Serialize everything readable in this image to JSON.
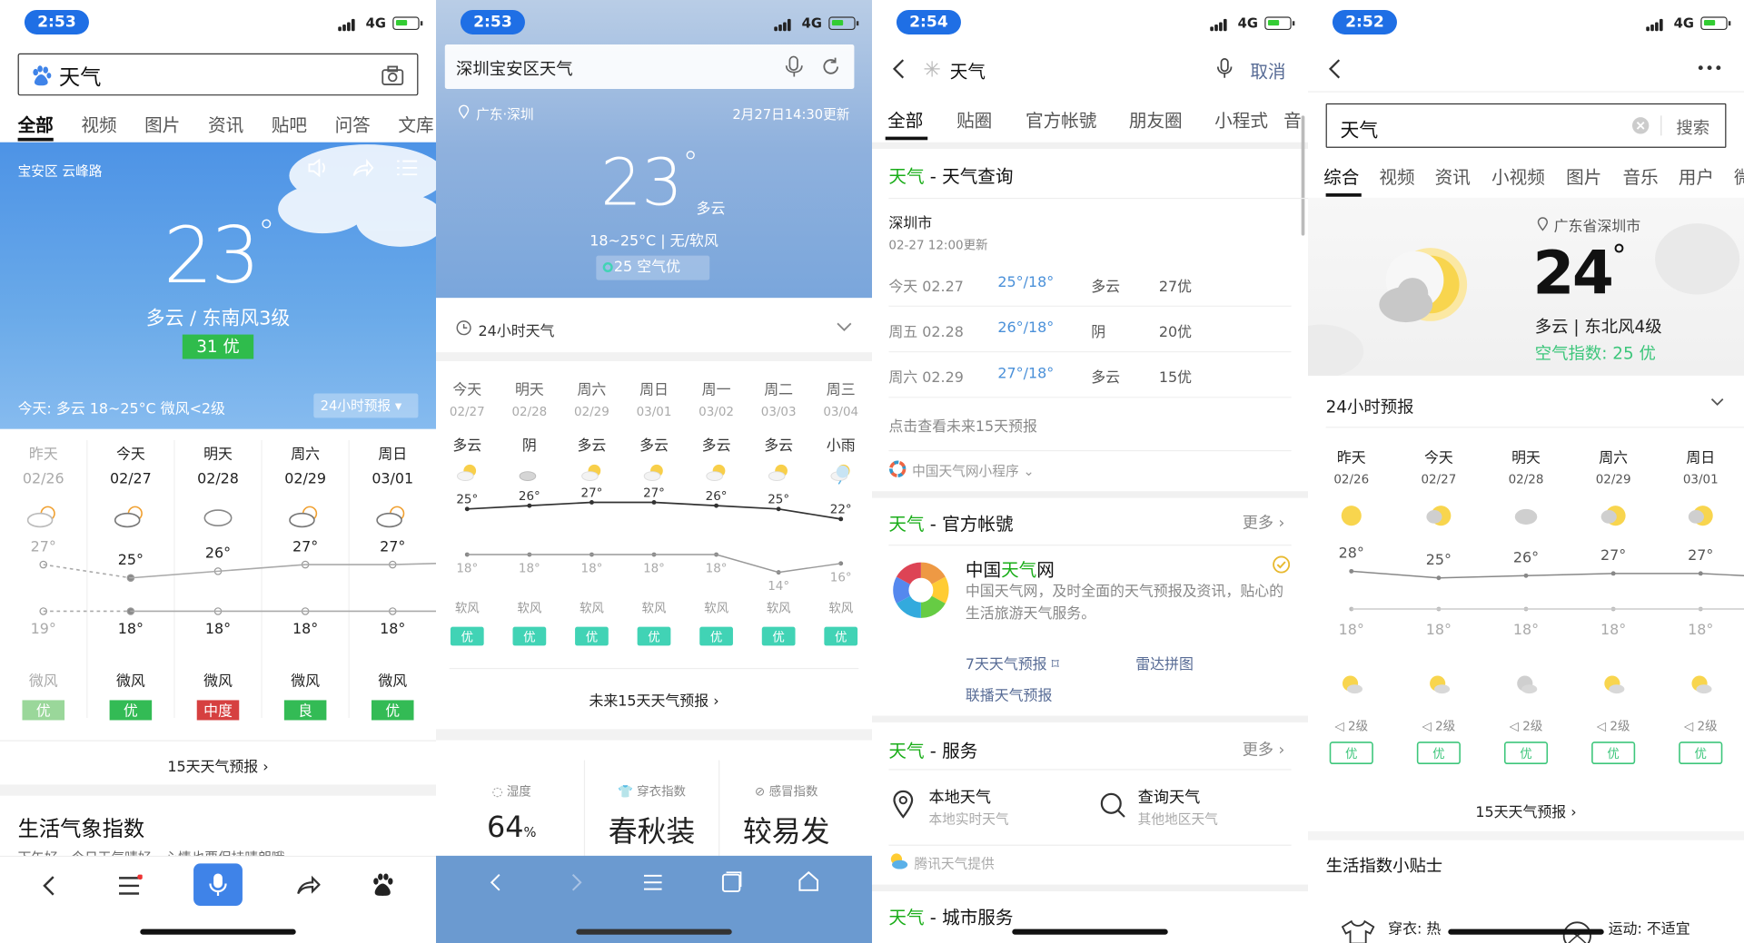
{
  "colors": {
    "baidu_blue": "#3f83e8",
    "green": "#33bb55",
    "orange": "#f0a030",
    "red": "#d64040",
    "teal": "#41d3b5"
  },
  "p1": {
    "time": "2:53",
    "net": "4G",
    "search_value": "天气",
    "tabs": [
      "全部",
      "视频",
      "图片",
      "资讯",
      "贴吧",
      "问答",
      "文库"
    ],
    "location": "宝安区 云峰路",
    "temp": "23",
    "deg": "°",
    "cond": "多云 / 东南风3级",
    "aqi": "31 优",
    "today": "今天: 多云 18~25°C 微风<2级",
    "forecast_btn": "24小时预报",
    "days": [
      {
        "name": "昨天",
        "date": "02/26",
        "hi": "27°",
        "lo": "19°",
        "wind": "微风",
        "aq": "优",
        "aqc": "#9ad79a"
      },
      {
        "name": "今天",
        "date": "02/27",
        "hi": "25°",
        "lo": "18°",
        "wind": "微风",
        "aq": "优",
        "aqc": "#33bb55"
      },
      {
        "name": "明天",
        "date": "02/28",
        "hi": "26°",
        "lo": "18°",
        "wind": "微风",
        "aq": "中度",
        "aqc": "#d64040"
      },
      {
        "name": "周六",
        "date": "02/29",
        "hi": "27°",
        "lo": "18°",
        "wind": "微风",
        "aq": "良",
        "aqc": "#33bb55"
      },
      {
        "name": "周日",
        "date": "03/01",
        "hi": "27°",
        "lo": "18°",
        "wind": "微风",
        "aq": "优",
        "aqc": "#33bb55"
      }
    ],
    "link15": "15天天气预报 ›",
    "life_title": "生活气象指数",
    "life_sub": "下午好，今日天气晴好，心情也要保持晴朗哦"
  },
  "p2": {
    "time": "2:53",
    "net": "4G",
    "search_value": "深圳宝安区天气",
    "location": "广东·深圳",
    "updated": "2月27日14:30更新",
    "temp": "23",
    "deg": "°",
    "cond": "多云",
    "range": "18~25°C | 无/软风",
    "aqi": "25 空气优",
    "h24": "24小时天气",
    "days": [
      {
        "name": "今天",
        "date": "02/27",
        "cond": "多云",
        "hi": "25°",
        "lo": "18°",
        "wind": "软风",
        "aq": "优"
      },
      {
        "name": "明天",
        "date": "02/28",
        "cond": "阴",
        "hi": "26°",
        "lo": "18°",
        "wind": "软风",
        "aq": "优"
      },
      {
        "name": "周六",
        "date": "02/29",
        "cond": "多云",
        "hi": "27°",
        "lo": "18°",
        "wind": "软风",
        "aq": "优"
      },
      {
        "name": "周日",
        "date": "03/01",
        "cond": "多云",
        "hi": "27°",
        "lo": "18°",
        "wind": "软风",
        "aq": "优"
      },
      {
        "name": "周一",
        "date": "03/02",
        "cond": "多云",
        "hi": "26°",
        "lo": "18°",
        "wind": "软风",
        "aq": "优"
      },
      {
        "name": "周二",
        "date": "03/03",
        "cond": "多云",
        "hi": "25°",
        "lo": "14°",
        "wind": "软风",
        "aq": "优"
      },
      {
        "name": "周三",
        "date": "03/04",
        "cond": "小雨",
        "hi": "22°",
        "lo": "16°",
        "wind": "软风",
        "aq": "优"
      }
    ],
    "link15": "未来15天天气预报 ›",
    "idx": [
      {
        "label": "湿度",
        "value": "64",
        "unit": "%"
      },
      {
        "label": "穿衣指数",
        "value": "春秋装"
      },
      {
        "label": "感冒指数",
        "value": "较易发"
      }
    ]
  },
  "p3": {
    "time": "2:54",
    "net": "4G",
    "search_value": "天气",
    "cancel": "取消",
    "tabs": [
      "全部",
      "贴圈",
      "官方帐號",
      "朋友圈",
      "小程式",
      "音"
    ],
    "sec1_kw": "天气",
    "sec1_rest": " - 天气查询",
    "city": "深圳市",
    "updated": "02-27 12:00更新",
    "rows": [
      {
        "day": "今天 02.27",
        "temp": "25°/18°",
        "cond": "多云",
        "aq": "27优"
      },
      {
        "day": "周五 02.28",
        "temp": "26°/18°",
        "cond": "阴",
        "aq": "20优"
      },
      {
        "day": "周六 02.29",
        "temp": "27°/18°",
        "cond": "多云",
        "aq": "15优"
      }
    ],
    "more15": "点击查看未来15天预报",
    "mini": "中国天气网小程序",
    "sec2_kw": "天气",
    "sec2_rest": " - 官方帐號",
    "more": "更多",
    "acct_a": "中国",
    "acct_kw": "天气",
    "acct_b": "网",
    "acct_desc": "中国天气网，及时全面的天气预报及资讯，贴心的生活旅游天气服务。",
    "links": [
      "7天天气预报",
      "雷达拼图",
      "联播天气预报"
    ],
    "sec3_kw": "天气",
    "sec3_rest": " - 服务",
    "svc1": "本地天气",
    "svc1_sub": "本地实时天气",
    "svc2": "查询天气",
    "svc2_sub": "其他地区天气",
    "provider": "腾讯天气提供",
    "sec4_kw": "天气",
    "sec4_rest": " - 城市服务"
  },
  "p4": {
    "time": "2:52",
    "net": "4G",
    "search_value": "天气",
    "search_btn": "搜索",
    "tabs": [
      "综合",
      "视频",
      "资讯",
      "小视频",
      "图片",
      "音乐",
      "用户",
      "微"
    ],
    "location": "广东省深圳市",
    "temp": "24",
    "deg": "°",
    "cond": "多云 | 东北风4级",
    "aqi": "空气指数: 25 优",
    "h24": "24小时预报",
    "days": [
      {
        "name": "昨天",
        "date": "02/26",
        "hi": "28°",
        "lo": "18°",
        "wind": "2级",
        "aq": "优"
      },
      {
        "name": "今天",
        "date": "02/27",
        "hi": "25°",
        "lo": "18°",
        "wind": "2级",
        "aq": "优"
      },
      {
        "name": "明天",
        "date": "02/28",
        "hi": "26°",
        "lo": "18°",
        "wind": "2级",
        "aq": "优"
      },
      {
        "name": "周六",
        "date": "02/29",
        "hi": "27°",
        "lo": "18°",
        "wind": "2级",
        "aq": "优"
      },
      {
        "name": "周日",
        "date": "03/01",
        "hi": "27°",
        "lo": "18°",
        "wind": "2级",
        "aq": "优"
      }
    ],
    "link15": "15天天气预报 ›",
    "life": "生活指数小贴士",
    "dress": "穿衣: 热",
    "sport": "运动: 不适宜"
  }
}
